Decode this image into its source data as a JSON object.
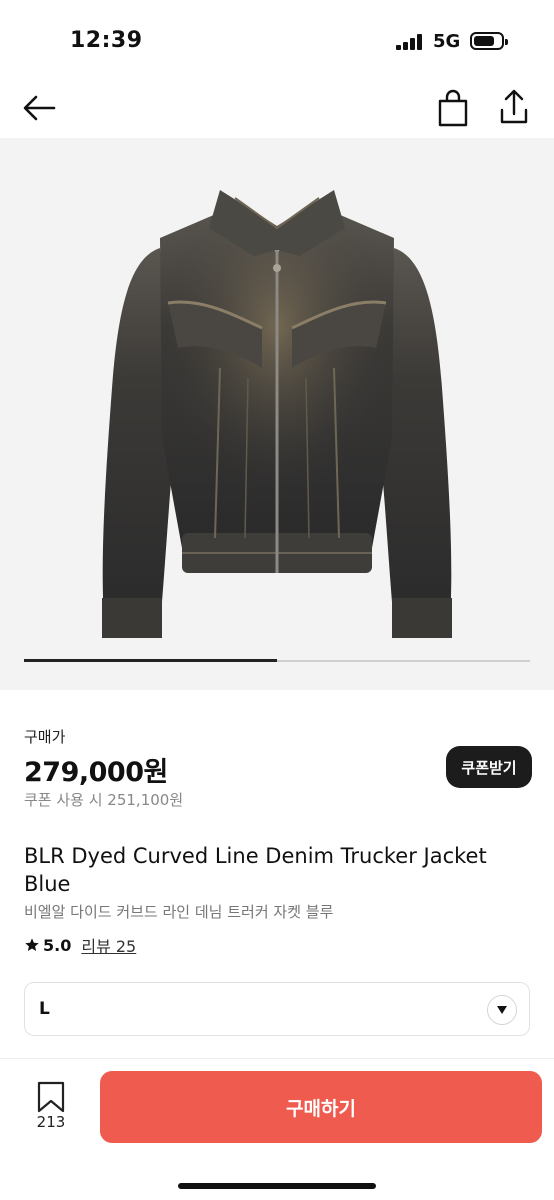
{
  "status_bar": {
    "time": "12:39",
    "network": "5G"
  },
  "nav": {
    "back_icon": "arrow-left-icon",
    "bag_icon": "shopping-bag-icon",
    "share_icon": "share-icon"
  },
  "gallery": {
    "image": "denim-jacket-photo",
    "progress": 0.5
  },
  "product": {
    "price_label": "구매가",
    "price": "279,000원",
    "coupon_note": "쿠폰 사용 시 251,100원",
    "coupon_button": "쿠폰받기",
    "title_en": "BLR Dyed Curved Line Denim Trucker Jacket Blue",
    "title_ko": "비엘알 다이드 커브드 라인 데님 트러커 자켓 블루",
    "rating": "5.0",
    "review_link": "리뷰 25"
  },
  "option": {
    "selected": "L"
  },
  "bottom": {
    "bookmark_count": "213",
    "buy_label": "구매하기"
  },
  "colors": {
    "buy_button": "#ef5b4f",
    "coupon_button": "#1c1c1c",
    "hero_bg": "#f3f3f3"
  }
}
